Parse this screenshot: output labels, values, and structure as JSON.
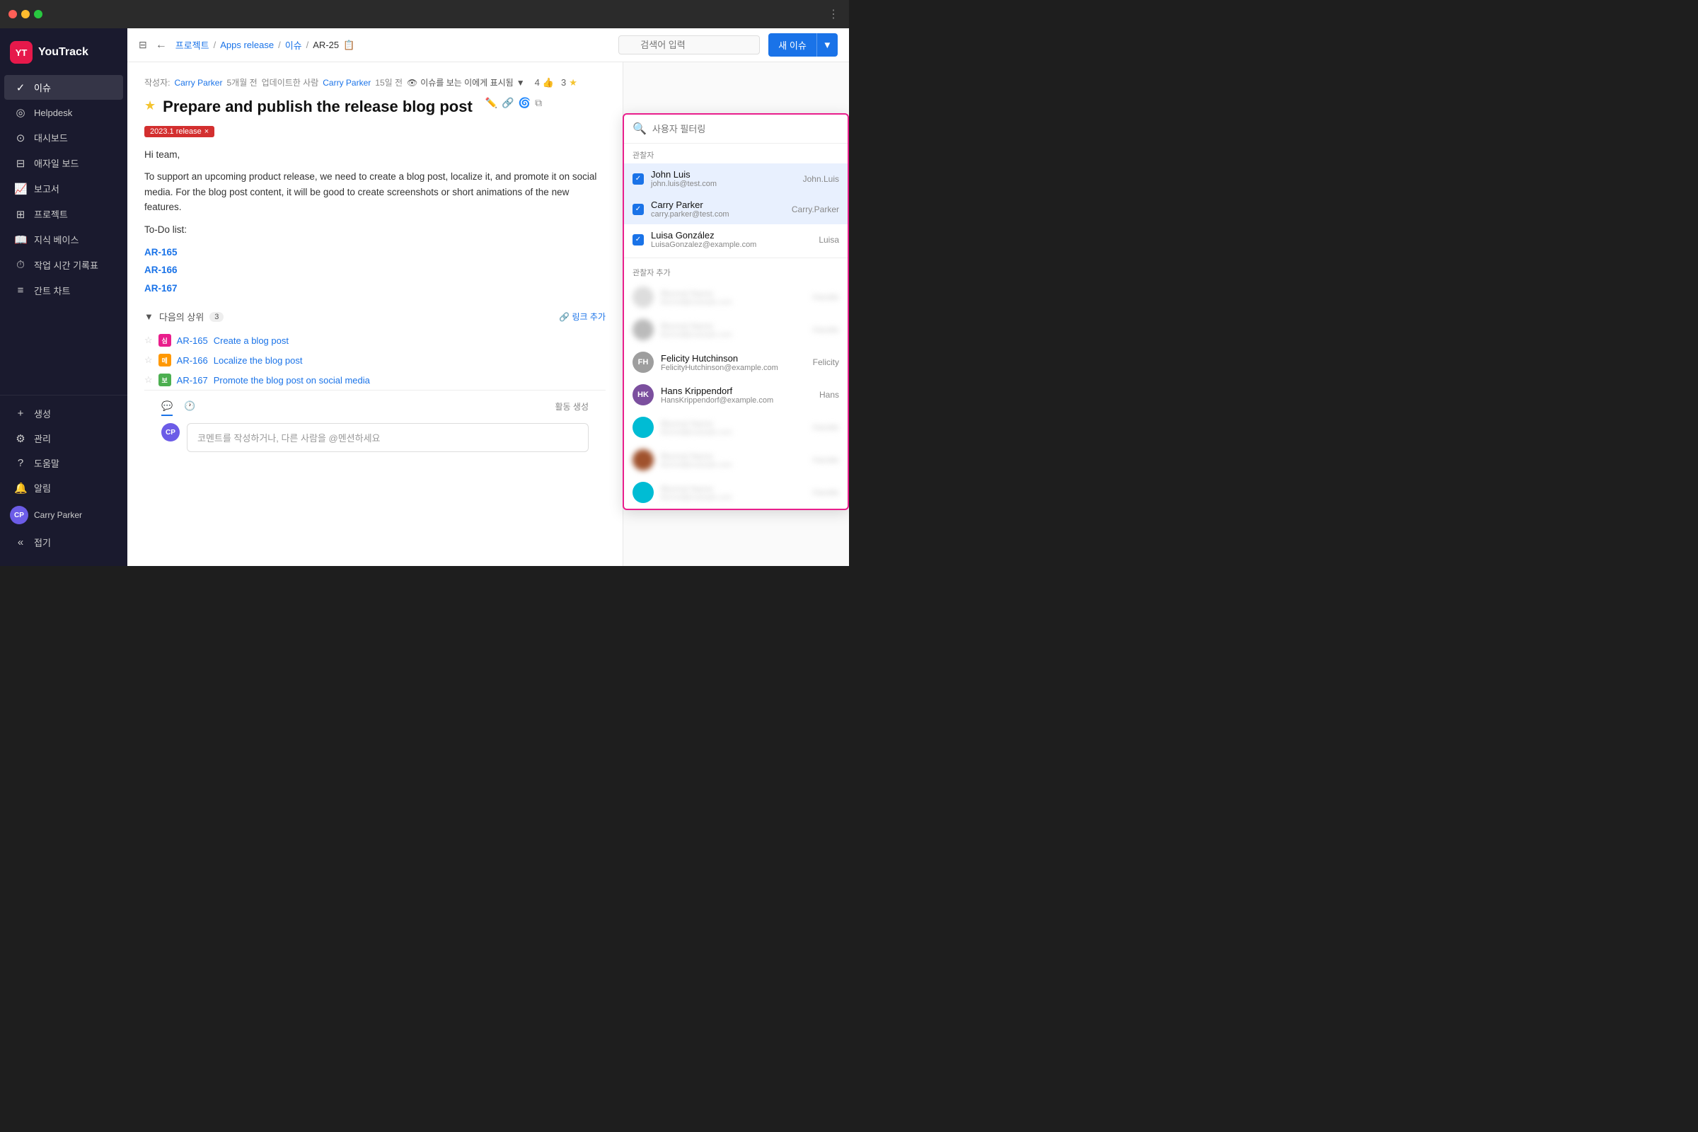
{
  "titlebar": {
    "menu_icon": "⋮"
  },
  "sidebar": {
    "logo_text": "YouTrack",
    "logo_abbr": "YT",
    "nav_items": [
      {
        "label": "이슈",
        "icon": "✓",
        "active": true
      },
      {
        "label": "Helpdesk",
        "icon": "🎧",
        "active": false
      },
      {
        "label": "대시보드",
        "icon": "◎",
        "active": false
      },
      {
        "label": "애자일 보드",
        "icon": "⊟",
        "active": false
      },
      {
        "label": "보고서",
        "icon": "📈",
        "active": false
      },
      {
        "label": "프로젝트",
        "icon": "⊞",
        "active": false
      },
      {
        "label": "지식 베이스",
        "icon": "📖",
        "active": false
      },
      {
        "label": "작업 시간 기록표",
        "icon": "⏱",
        "active": false
      },
      {
        "label": "간트 차트",
        "icon": "👤",
        "active": false
      }
    ],
    "bottom_items": [
      {
        "label": "생성",
        "icon": "+"
      },
      {
        "label": "관리",
        "icon": "⚙"
      },
      {
        "label": "도움말",
        "icon": "?"
      },
      {
        "label": "알림",
        "icon": "🔔"
      }
    ],
    "user_name": "Carry Parker",
    "collapse_label": "접기"
  },
  "topbar": {
    "toggle_icon": "⊟",
    "back_icon": "←",
    "breadcrumb": {
      "project": "프로젝트",
      "section": "Apps release",
      "subsection": "이슈",
      "issue_id": "AR-25",
      "copy_icon": "📋"
    },
    "search_placeholder": "검색어 입력",
    "new_issue_label": "새 이슈",
    "dropdown_icon": "▼"
  },
  "issue": {
    "author": "Carry Parker",
    "created": "5개월 전",
    "updater": "Carry Parker",
    "updated": "15일 전",
    "watch_label": "이슈를 보는 이에게 표시됨",
    "watch_icon": "👁",
    "likes": "4",
    "stars": "3",
    "star_filled": "★",
    "title": "Prepare and publish the release blog post",
    "tag_label": "2023.1 release",
    "tag_close": "×",
    "body_greeting": "Hi team,",
    "body_text": "To support an upcoming product release, we need to create a blog post, localize it, and promote it on social media. For the blog post content, it will be good to create screenshots or short animations of the new features.",
    "todo_label": "To-Do list:",
    "links": [
      "AR-165",
      "AR-166",
      "AR-167"
    ],
    "subsection_label": "다음의 상위",
    "subsection_count": "3",
    "add_link_label": "🔗 링크 추가",
    "subtasks": [
      {
        "id": "AR-165",
        "title": "Create a blog post",
        "badge_color": "badge-pink",
        "badge_text": "심"
      },
      {
        "id": "AR-166",
        "title": "Localize the blog post",
        "badge_color": "badge-orange",
        "badge_text": "메"
      },
      {
        "id": "AR-167",
        "title": "Promote the blog post on social media",
        "badge_color": "badge-green",
        "badge_text": "보"
      }
    ],
    "comment_tab_comment": "💬",
    "comment_tab_history": "🕐",
    "comment_tab_activity": "활동 생성",
    "comment_placeholder": "코멘트를 작성하거나, 다른 사람을 @멘션하세요"
  },
  "observer_dropdown": {
    "search_placeholder": "사용자 필터링",
    "section_label": "관찰자",
    "add_section_label": "관찰자 추가",
    "observers": [
      {
        "name": "John Luis",
        "email": "john.luis@test.com",
        "handle": "John.Luis",
        "checked": true
      },
      {
        "name": "Carry Parker",
        "email": "carry.parker@test.com",
        "handle": "Carry.Parker",
        "checked": true
      },
      {
        "name": "Luisa González",
        "email": "LuisaGonzalez@example.com",
        "handle": "Luisa",
        "checked": true
      }
    ],
    "add_users": [
      {
        "name": "Felicity Hutchinson",
        "email": "FelicityHutchinson@example.com",
        "handle": "Felicity",
        "avatar_type": "felicity"
      },
      {
        "name": "Hans Krippendorf",
        "email": "HansKrippendorf@example.com",
        "handle": "Hans",
        "avatar_type": "hans"
      }
    ]
  }
}
